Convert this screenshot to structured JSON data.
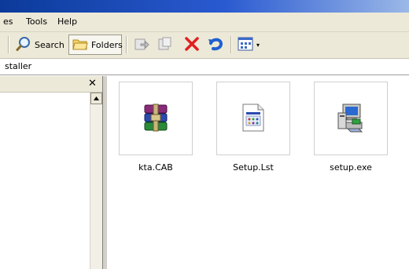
{
  "menu": {
    "items": [
      "es",
      "Tools",
      "Help"
    ]
  },
  "toolbar": {
    "search_label": "Search",
    "folders_label": "Folders",
    "icons": [
      "back-icon",
      "forward-icon",
      "delete-icon",
      "undo-icon",
      "views-icon"
    ]
  },
  "address": {
    "value": "staller"
  },
  "files": [
    {
      "name": "kta.CAB",
      "icon": "winrar-archive-icon"
    },
    {
      "name": "Setup.Lst",
      "icon": "text-document-icon"
    },
    {
      "name": "setup.exe",
      "icon": "installer-icon"
    }
  ],
  "colors": {
    "delete": "#e02020",
    "undo": "#1f5fd0",
    "accent": "#0b3a9a"
  }
}
